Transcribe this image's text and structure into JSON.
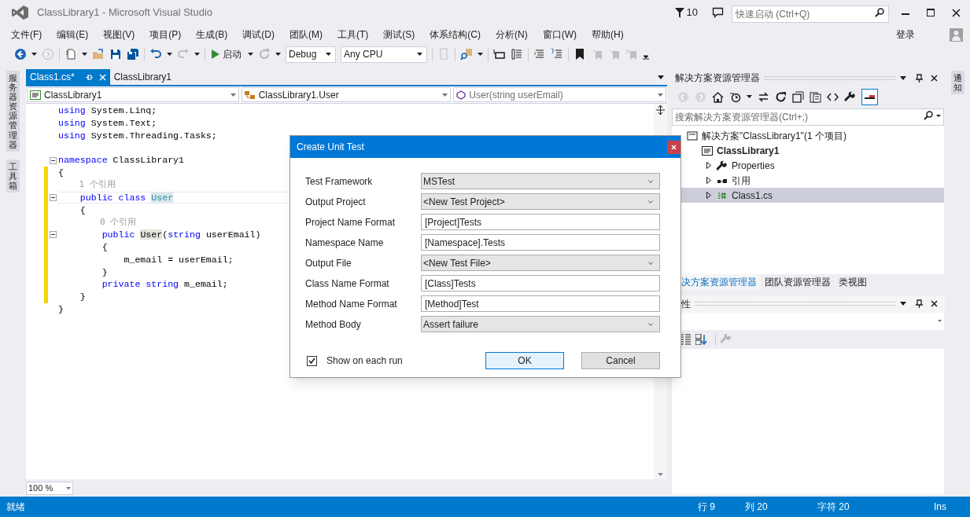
{
  "window": {
    "title": "ClassLibrary1 - Microsoft Visual Studio",
    "notification_count": "10",
    "quick_launch": {
      "placeholder": "快速启动 (Ctrl+Q)"
    },
    "sign_in": "登录"
  },
  "menu": [
    "文件(F)",
    "编辑(E)",
    "视图(V)",
    "项目(P)",
    "生成(B)",
    "调试(D)",
    "团队(M)",
    "工具(T)",
    "测试(S)",
    "体系结构(C)",
    "分析(N)",
    "窗口(W)",
    "帮助(H)"
  ],
  "toolbar": {
    "start": "启动",
    "configuration": "Debug",
    "platform": "Any CPU"
  },
  "side_tabs_left": [
    "服务器资源管理器",
    "工具箱"
  ],
  "side_tabs_right": [
    "通知"
  ],
  "editor": {
    "tabs": [
      {
        "label": "Class1.cs*",
        "selected": true
      },
      {
        "label": "ClassLibrary1",
        "selected": false
      }
    ],
    "navigation": [
      "ClassLibrary1",
      "ClassLibrary1.User",
      "User(string userEmail)"
    ],
    "lines": [
      {
        "kind": "code",
        "fold": false,
        "changed": false,
        "current": false,
        "tokens": [
          {
            "kind": "keyword",
            "text": "using"
          },
          {
            "kind": "plain",
            "text": " System.Linq;"
          }
        ]
      },
      {
        "kind": "code",
        "fold": false,
        "changed": false,
        "current": false,
        "tokens": [
          {
            "kind": "keyword",
            "text": "using"
          },
          {
            "kind": "plain",
            "text": " System.Text;"
          }
        ]
      },
      {
        "kind": "code",
        "fold": false,
        "changed": false,
        "current": false,
        "tokens": [
          {
            "kind": "keyword",
            "text": "using"
          },
          {
            "kind": "plain",
            "text": " System.Threading.Tasks;"
          }
        ]
      },
      {
        "kind": "blank",
        "changed": false
      },
      {
        "kind": "code",
        "fold": true,
        "changed": false,
        "current": false,
        "tokens": [
          {
            "kind": "keyword",
            "text": "namespace"
          },
          {
            "kind": "plain",
            "text": " ClassLibrary1"
          }
        ]
      },
      {
        "kind": "code",
        "fold": false,
        "changed": true,
        "current": false,
        "tokens": [
          {
            "kind": "plain",
            "text": "{"
          }
        ]
      },
      {
        "kind": "lens",
        "changed": true,
        "text": "    1 个引用"
      },
      {
        "kind": "code",
        "fold": true,
        "changed": true,
        "current": true,
        "tokens": [
          {
            "kind": "keyword",
            "text": "    public class "
          },
          {
            "kind": "type_ref",
            "text": "User"
          }
        ]
      },
      {
        "kind": "code",
        "fold": false,
        "changed": true,
        "current": false,
        "tokens": [
          {
            "kind": "plain",
            "text": "    {"
          }
        ]
      },
      {
        "kind": "lens",
        "changed": true,
        "text": "        0 个引用"
      },
      {
        "kind": "code",
        "fold": true,
        "changed": true,
        "current": false,
        "tokens": [
          {
            "kind": "keyword",
            "text": "        public "
          },
          {
            "kind": "ref",
            "text": "User"
          },
          {
            "kind": "plain",
            "text": "("
          },
          {
            "kind": "keyword",
            "text": "string"
          },
          {
            "kind": "plain",
            "text": " userEmail)"
          }
        ]
      },
      {
        "kind": "code",
        "fold": false,
        "changed": true,
        "current": false,
        "tokens": [
          {
            "kind": "plain",
            "text": "        {"
          }
        ]
      },
      {
        "kind": "code",
        "fold": false,
        "changed": true,
        "current": false,
        "tokens": [
          {
            "kind": "plain",
            "text": "            m_email = userEmail;"
          }
        ]
      },
      {
        "kind": "code",
        "fold": false,
        "changed": true,
        "current": false,
        "tokens": [
          {
            "kind": "plain",
            "text": "        }"
          }
        ]
      },
      {
        "kind": "code",
        "fold": false,
        "changed": true,
        "current": false,
        "tokens": [
          {
            "kind": "keyword",
            "text": "        private string"
          },
          {
            "kind": "plain",
            "text": " m_email;"
          }
        ]
      },
      {
        "kind": "code",
        "fold": false,
        "changed": true,
        "current": false,
        "tokens": [
          {
            "kind": "plain",
            "text": "    }"
          }
        ]
      },
      {
        "kind": "code",
        "fold": false,
        "changed": false,
        "current": false,
        "tokens": [
          {
            "kind": "plain",
            "text": "}"
          }
        ]
      }
    ],
    "zoom": "100 %"
  },
  "solution_explorer": {
    "title": "解决方案资源管理器",
    "search": {
      "placeholder": "搜索解决方案资源管理器(Ctrl+;)"
    },
    "tree": [
      {
        "kind": "solution",
        "label": "解决方案\"ClassLibrary1\"(1 个项目)",
        "selected": false,
        "children": [
          {
            "kind": "project",
            "label": "ClassLibrary1",
            "selected": false,
            "children": [
              {
                "kind": "properties",
                "label": "Properties",
                "expanded": false,
                "selected": false
              },
              {
                "kind": "references",
                "label": "引用",
                "expanded": false,
                "selected": false
              },
              {
                "kind": "csfile",
                "label": "Class1.cs",
                "expanded": false,
                "selected": true
              }
            ]
          }
        ]
      }
    ],
    "tabs": [
      {
        "label": "决方案资源管理器",
        "selected": true
      },
      {
        "label": "团队资源管理器",
        "selected": false
      },
      {
        "label": "类视图",
        "selected": false
      }
    ]
  },
  "properties": {
    "title": "性"
  },
  "dialog": {
    "title": "Create Unit Test",
    "fields": [
      {
        "kind": "dropdown",
        "label": "Test Framework",
        "value": "MSTest"
      },
      {
        "kind": "dropdown",
        "label": "Output Project",
        "value": "<New Test Project>"
      },
      {
        "kind": "text",
        "label": "Project Name Format",
        "value": "[Project]Tests"
      },
      {
        "kind": "text",
        "label": "Namespace Name",
        "value": "[Namespace].Tests"
      },
      {
        "kind": "dropdown",
        "label": "Output File",
        "value": "<New Test File>"
      },
      {
        "kind": "text",
        "label": "Class Name Format",
        "value": "[Class]Tests"
      },
      {
        "kind": "text",
        "label": "Method Name Format",
        "value": "[Method]Test"
      },
      {
        "kind": "dropdown",
        "label": "Method Body",
        "value": "Assert failure"
      }
    ],
    "show_each_run": {
      "label": "Show on each run",
      "checked": true
    },
    "buttons": [
      {
        "label": "OK",
        "default": true
      },
      {
        "label": "Cancel",
        "default": false
      }
    ]
  },
  "status_bar": {
    "message": "就绪",
    "line": "行 9",
    "column": "列 20",
    "character": "字符 20",
    "mode": "Ins"
  }
}
